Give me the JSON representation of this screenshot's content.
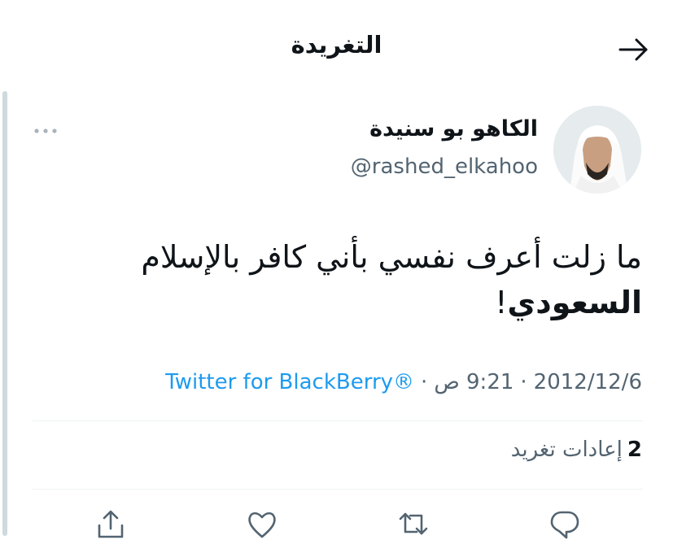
{
  "header": {
    "title": "التغريدة",
    "back_icon": "arrow-right-icon"
  },
  "author": {
    "display_name": "الكاهو بو سنيدة",
    "handle": "@rashed_elkahoo"
  },
  "tweet": {
    "line1": "ما زلت أعرف نفسي بأني كافر بالإسلام",
    "line2_bold": "السعودي",
    "line2_rest": "!"
  },
  "meta": {
    "date": "2012/12/6",
    "separator": "·",
    "time": "9:21 ص",
    "source": "Twitter for BlackBerry®"
  },
  "stats": {
    "retweets_count": "2",
    "retweets_label": "إعادات تغريد"
  },
  "actions": [
    "reply-icon",
    "retweet-icon",
    "like-icon",
    "share-icon"
  ],
  "colors": {
    "link": "#1d9bf0",
    "secondary": "#536471",
    "text": "#0f1419"
  }
}
